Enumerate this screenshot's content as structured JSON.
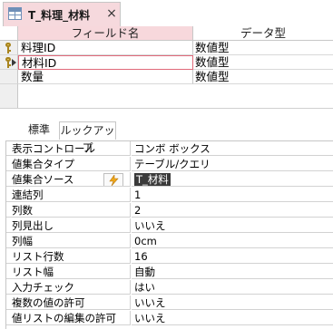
{
  "document_tab": {
    "title": "T_料理_材料",
    "icon": "table-icon",
    "close_label": "×",
    "active_color": "#f6d9dd"
  },
  "field_grid": {
    "columns": [
      "フィールド名",
      "データ型"
    ],
    "rows": [
      {
        "name": "料理ID",
        "type": "数値型",
        "primary_key": true
      },
      {
        "name": "材料ID",
        "type": "数値型",
        "primary_key": true,
        "current": true
      },
      {
        "name": "数量",
        "type": "数値型",
        "primary_key": false
      }
    ]
  },
  "property_tabs": [
    "標準",
    "ルックアップ"
  ],
  "active_property_tab": "ルックアップ",
  "properties": [
    {
      "name": "表示コントロール",
      "value": "コンボ ボックス"
    },
    {
      "name": "値集合タイプ",
      "value": "テーブル/クエリ"
    },
    {
      "name": "値集合ソース",
      "value": "T_材料",
      "selected": true,
      "builder_icon": "lightning-build-icon"
    },
    {
      "name": "連結列",
      "value": "1"
    },
    {
      "name": "列数",
      "value": "2"
    },
    {
      "name": "列見出し",
      "value": "いいえ"
    },
    {
      "name": "列幅",
      "value": "0cm"
    },
    {
      "name": "リスト行数",
      "value": "16"
    },
    {
      "name": "リスト幅",
      "value": "自動"
    },
    {
      "name": "入力チェック",
      "value": "はい"
    },
    {
      "name": "複数の値の許可",
      "value": "いいえ"
    },
    {
      "name": "値リストの編集の許可",
      "value": "いいえ"
    }
  ]
}
